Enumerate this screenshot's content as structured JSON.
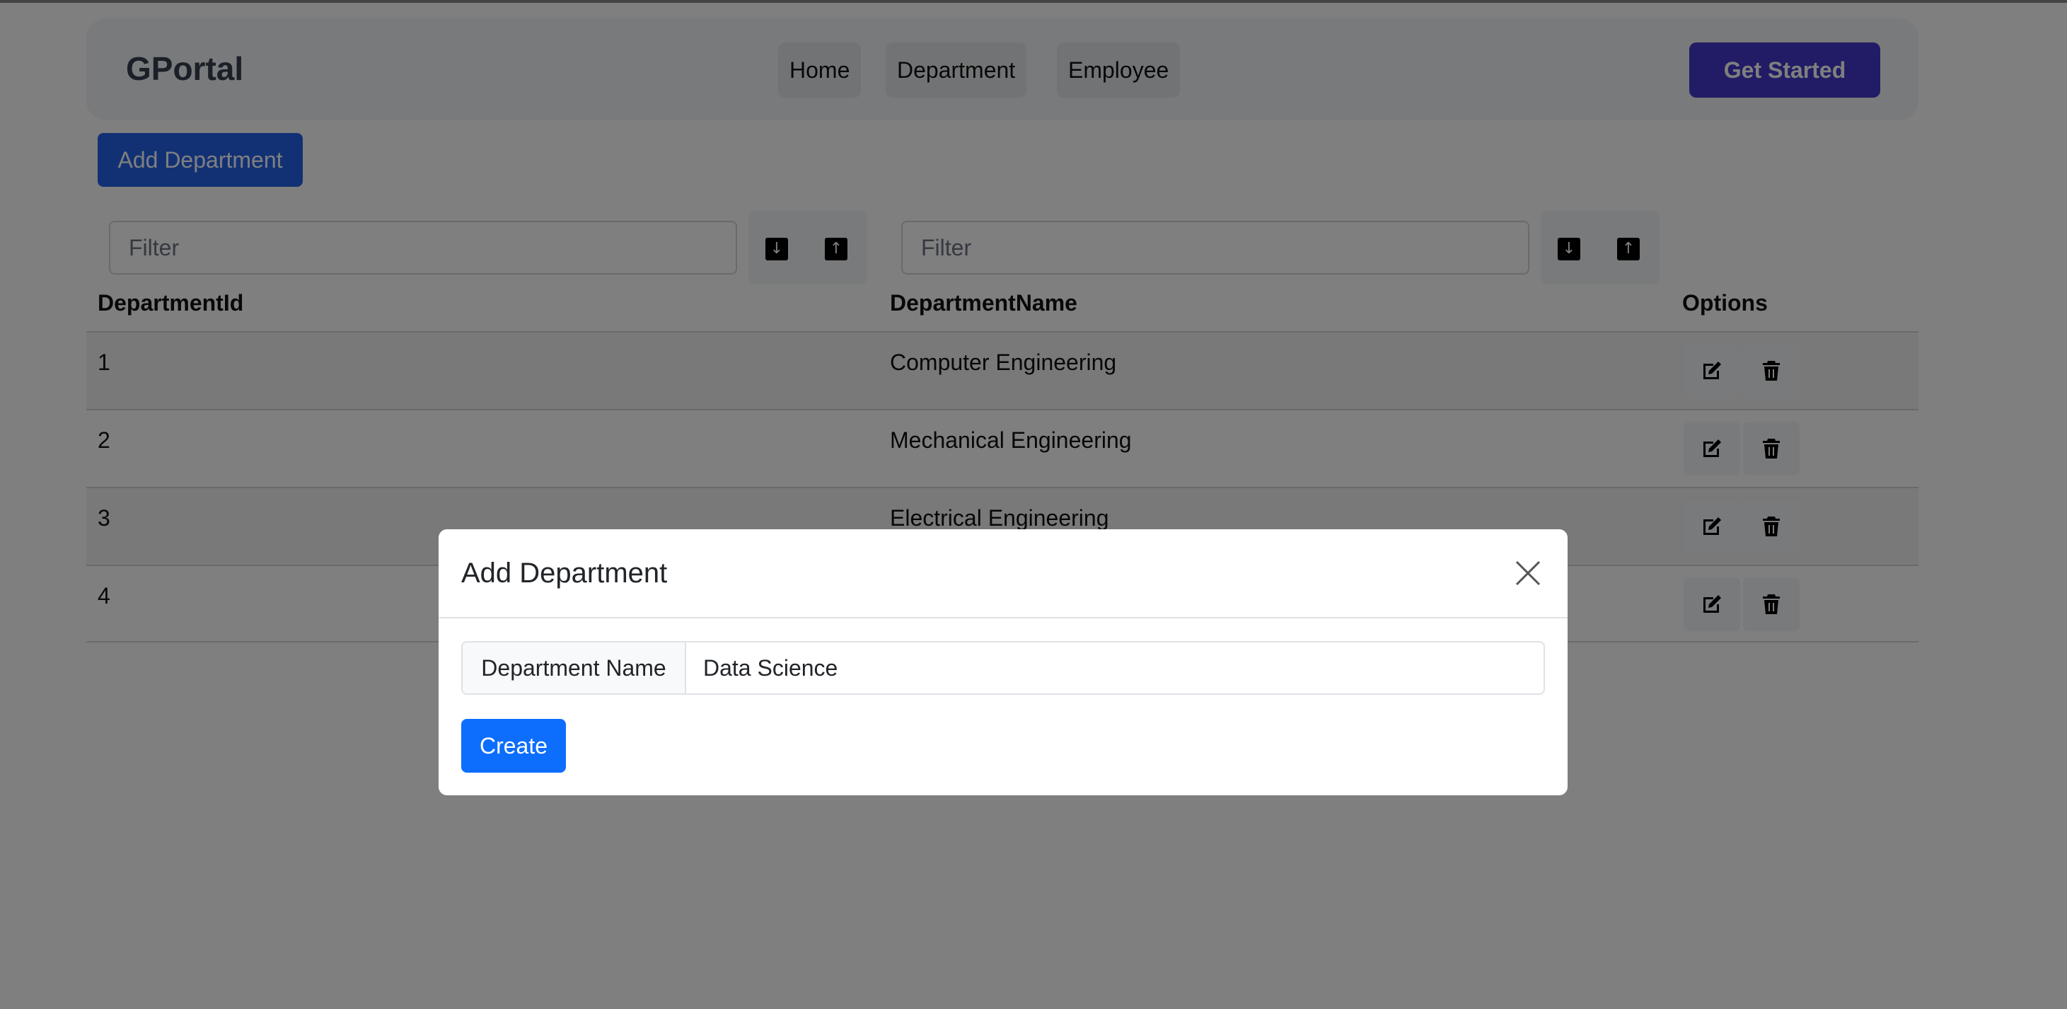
{
  "navbar": {
    "brand": "GPortal",
    "links": [
      "Home",
      "Department",
      "Employee"
    ],
    "cta": "Get Started"
  },
  "toolbar": {
    "add_department": "Add Department"
  },
  "filters": {
    "id_placeholder": "Filter",
    "name_placeholder": "Filter",
    "sort_desc_icon": "arrow-down-icon",
    "sort_asc_icon": "arrow-up-icon"
  },
  "table": {
    "headers": [
      "DepartmentId",
      "DepartmentName",
      "Options"
    ],
    "rows": [
      {
        "id": "1",
        "name": "Computer Engineering"
      },
      {
        "id": "2",
        "name": "Mechanical Engineering"
      },
      {
        "id": "3",
        "name": "Electrical Engineering"
      },
      {
        "id": "4",
        "name": ""
      }
    ],
    "row_icons": [
      "edit-icon",
      "trash-icon"
    ]
  },
  "modal": {
    "title": "Add Department",
    "field_label": "Department Name",
    "field_value": "Data Science",
    "create": "Create"
  },
  "colors": {
    "primary": "#0d6efd",
    "brand_button": "#4338ca",
    "add_button": "#2563eb"
  }
}
